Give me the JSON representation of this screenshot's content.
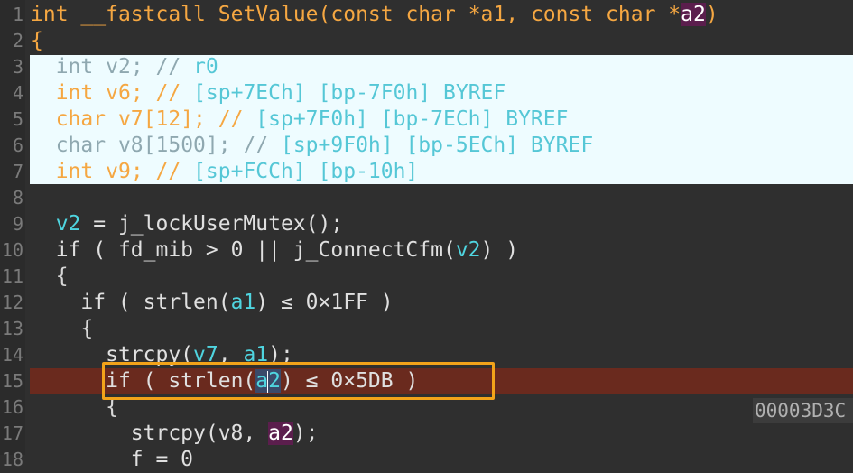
{
  "editor": {
    "line_numbers": [
      "1",
      "2",
      "3",
      "4",
      "5",
      "6",
      "7",
      "8",
      "9",
      "10",
      "11",
      "12",
      "13",
      "14",
      "15",
      "16",
      "17",
      "18"
    ],
    "signature": {
      "ret": "int",
      "conv": "__fastcall",
      "name": "SetValue",
      "p1": "(const char *",
      "a1": "a1",
      "p2": ", const char *",
      "a2": "a2",
      "close": ")"
    },
    "open_brace": "{",
    "locals": [
      {
        "type": "int",
        "name": "v2",
        "rest": "; // ",
        "comment": "r0"
      },
      {
        "type": "int",
        "name": "v6",
        "rest": "; // ",
        "comment": "[sp+7ECh] [bp-7F0h] BYREF"
      },
      {
        "type": "char",
        "name": "v7",
        "rest": "[12]; // ",
        "comment": "[sp+7F0h] [bp-7ECh] BYREF"
      },
      {
        "type": "char",
        "name": "v8",
        "rest": "[1500]; // ",
        "comment": "[sp+9F0h] [bp-5ECh] BYREF"
      },
      {
        "type": "int",
        "name": "v9",
        "rest": "; // ",
        "comment": "[sp+FCCh] [bp-10h]"
      }
    ],
    "lines": {
      "l9": {
        "a": "v2",
        "b": " = j_lockUserMutex();"
      },
      "l10": {
        "a": "if ( fd_mib > 0 || j_ConnectCfm(",
        "b": "v2",
        "c": ") )"
      },
      "l11": "{",
      "l12": {
        "a": "if ( strlen(",
        "b": "a1",
        "c": ") ≤ 0×1FF )"
      },
      "l13": "{",
      "l14": {
        "a": "strcpy(",
        "b": "v7",
        "c": ", ",
        "d": "a1",
        "e": ");"
      },
      "l15": {
        "a": "if ( strlen(",
        "b1": "a",
        "b2": "2",
        "c": ") ≤ 0×5DB )"
      },
      "l16": "{",
      "l17": {
        "a": "strcpy(v8, ",
        "b": "a2",
        "c": ");"
      },
      "l18": "f = 0"
    },
    "address": "00003D3C"
  }
}
